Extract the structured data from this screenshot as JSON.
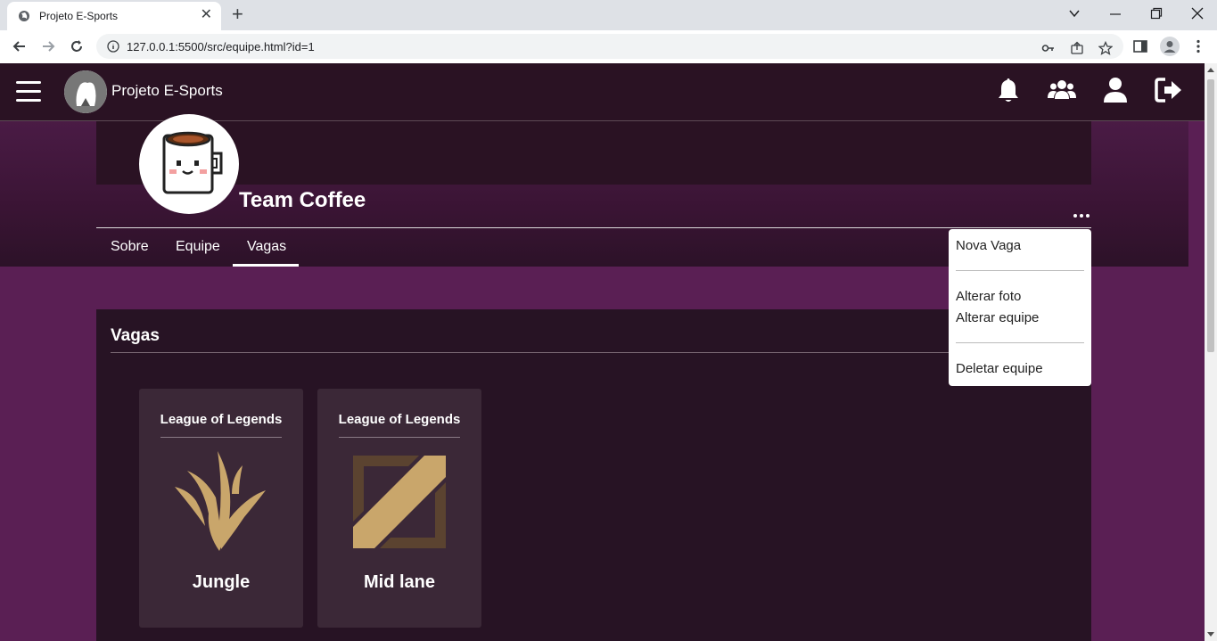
{
  "browser": {
    "tab_title": "Projeto E-Sports",
    "url": "127.0.0.1:5500/src/equipe.html?id=1"
  },
  "header": {
    "app_title": "Projeto E-Sports"
  },
  "team": {
    "name": "Team Coffee"
  },
  "tabs": [
    {
      "label": "Sobre"
    },
    {
      "label": "Equipe"
    },
    {
      "label": "Vagas",
      "active": true
    }
  ],
  "vagas": {
    "title": "Vagas",
    "cards": [
      {
        "game": "League of Legends",
        "role": "Jungle"
      },
      {
        "game": "League of Legends",
        "role": "Mid lane"
      }
    ]
  },
  "menu": {
    "items": [
      "Nova Vaga",
      "Alterar foto",
      "Alterar equipe",
      "Deletar equipe"
    ]
  },
  "colors": {
    "header_bg": "#2a1223",
    "page_bg": "#5a1f54",
    "panel_bg": "#271324",
    "card_bg": "#3b2837",
    "role_icon_gold": "#c9a66b"
  }
}
